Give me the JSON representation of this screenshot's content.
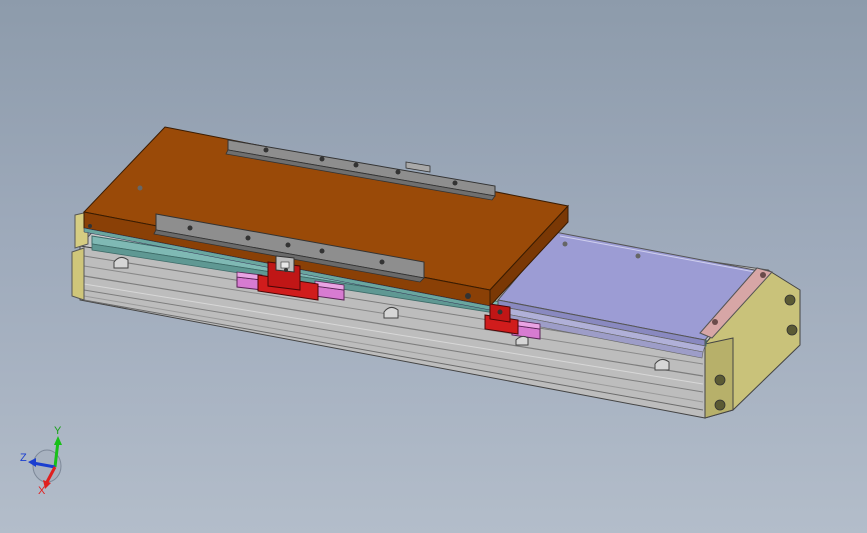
{
  "triad": {
    "x_label": "X",
    "y_label": "Y",
    "z_label": "Z"
  },
  "colors": {
    "background_top": "#8d9bab",
    "background_bottom": "#b3bdca",
    "carriage_plate": "#9a4a08",
    "guide_rail": "#7fb9b4",
    "cover_sheet": "#9c9cd4",
    "end_plate": "#c9c27a",
    "clamp_block": "#d01c1c",
    "slider_pad": "#d77bd1",
    "body_profile": "#b8b8b8",
    "triad_x": "#e02020",
    "triad_y": "#18c018",
    "triad_z": "#1a3ed0"
  },
  "icons": {
    "triad": "xyz-axis-triad-icon"
  }
}
